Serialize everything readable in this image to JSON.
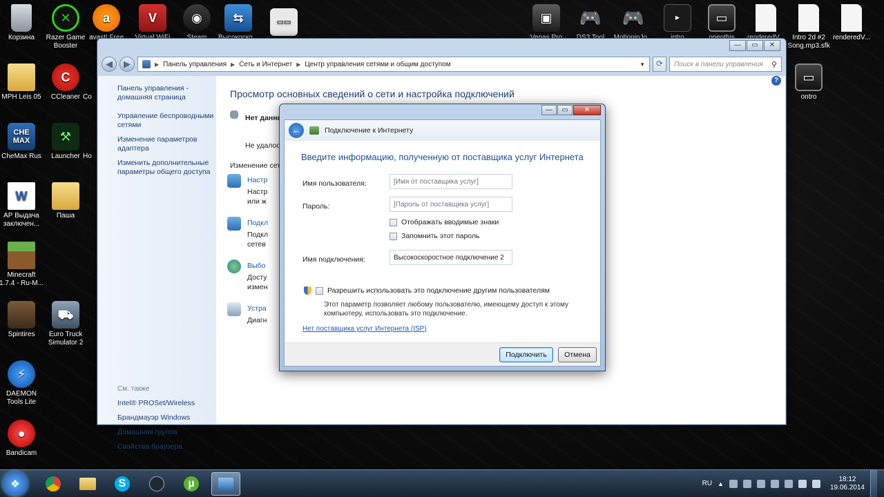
{
  "desktop": {
    "left_icons": [
      {
        "label": "Корзина",
        "icon": "recycle-bin-icon"
      },
      {
        "label": "Razer Game Booster",
        "icon": "razer-icon"
      },
      {
        "label": "avast! Free",
        "icon": "avast-icon"
      },
      {
        "label": "Virtual WiFi",
        "icon": "wifi-router-icon"
      },
      {
        "label": "Steam",
        "icon": "steam-icon"
      },
      {
        "label": "Высокоско...",
        "icon": "network-icon"
      },
      {
        "label": "bandicam",
        "icon": "bandicam-folder-icon"
      },
      {
        "label": "MPH Leis 05",
        "icon": "folder-icon"
      },
      {
        "label": "CCleaner",
        "icon": "ccleaner-icon"
      },
      {
        "label": "Co",
        "icon": "app-icon"
      },
      {
        "label": "CheMax Rus",
        "icon": "chemax-icon"
      },
      {
        "label": "Launcher",
        "icon": "launcher-icon"
      },
      {
        "label": "Ho",
        "icon": "app-icon"
      },
      {
        "label": "AP Выдача заключен...",
        "icon": "word-document-icon"
      },
      {
        "label": "Паша",
        "icon": "folder-icon"
      },
      {
        "label": "Minecraft 1.7.4 - Ru-M...",
        "icon": "minecraft-icon"
      },
      {
        "label": "Spintires",
        "icon": "spintires-icon"
      },
      {
        "label": "Euro Truck Simulator 2",
        "icon": "truck-icon"
      },
      {
        "label": "DAEMON Tools Lite",
        "icon": "daemon-tools-icon"
      },
      {
        "label": "Bandicam",
        "icon": "bandicam-icon"
      }
    ],
    "right_icons": [
      {
        "label": "Vegas Pro",
        "icon": "vegas-icon"
      },
      {
        "label": "DS3 Tool",
        "icon": "gamepad-icon"
      },
      {
        "label": "MotioninJo...",
        "icon": "gamepad-icon"
      },
      {
        "label": "intro",
        "icon": "video-icon"
      },
      {
        "label": "openthis",
        "icon": "video-icon"
      },
      {
        "label": "renderedV...",
        "icon": "file-icon"
      },
      {
        "label": "Intro 2d #2 Song.mp3.sfk",
        "icon": "file-icon"
      },
      {
        "label": "renderedV...",
        "icon": "file-icon"
      },
      {
        "label": "ontro",
        "icon": "video-icon"
      }
    ]
  },
  "explorer": {
    "breadcrumb": [
      "Панель управления",
      "Сеть и Интернет",
      "Центр управления сетями и общим доступом"
    ],
    "search_placeholder": "Поиск в панели управления",
    "nav_links": [
      "Панель управления - домашняя страница",
      "Управление беспроводными сетями",
      "Изменение параметров адаптера",
      "Изменить дополнительные параметры общего доступа"
    ],
    "see_also_header": "См. также",
    "see_also_links": [
      "Intel® PROSet/Wireless",
      "Брандмауэр Windows",
      "Домашняя группа",
      "Свойства браузера"
    ],
    "content_title": "Просмотр основных сведений о сети и настройка подключений",
    "bg_no_data": "Нет данны",
    "bg_failed": "Не удалос",
    "bg_change_header": "Изменение сете",
    "bg_items": [
      {
        "link": "Настр",
        "text": "Настр",
        "text2": "или ж"
      },
      {
        "link": "Подкл",
        "text": "Подкл",
        "text2": "сетев"
      },
      {
        "link": "Выбо",
        "text": "Досту",
        "text2": "измен"
      },
      {
        "link": "Устра",
        "text": "Диагн",
        "text2": ""
      }
    ]
  },
  "dialog": {
    "title": "Подключение к Интернету",
    "heading": "Введите информацию, полученную от поставщика услуг Интернета",
    "username_label": "Имя пользователя:",
    "username_placeholder": "[Имя от поставщика услуг]",
    "password_label": "Пароль:",
    "password_placeholder": "[Пароль от поставщика услуг]",
    "show_chars_label": "Отображать вводимые знаки",
    "remember_label": "Запомнить этот пароль",
    "conn_name_label": "Имя подключения:",
    "conn_name_value": "Высокоскоростное подключение 2",
    "allow_others_label": "Разрешить использовать это подключение другим пользователям",
    "allow_others_desc": "Этот параметр позволяет любому пользователю, имеющему доступ к этому компьютеру, использовать это подключение.",
    "no_isp_link": "Нет поставщика услуг Интернета (ISP)",
    "connect_button": "Подключить",
    "cancel_button": "Отмена"
  },
  "taskbar": {
    "apps": [
      "chrome-icon",
      "explorer-folder-icon",
      "skype-icon",
      "steam-icon",
      "utorrent-icon",
      "control-panel-icon"
    ],
    "language": "RU",
    "time": "18:12",
    "date": "19.06.2014"
  }
}
